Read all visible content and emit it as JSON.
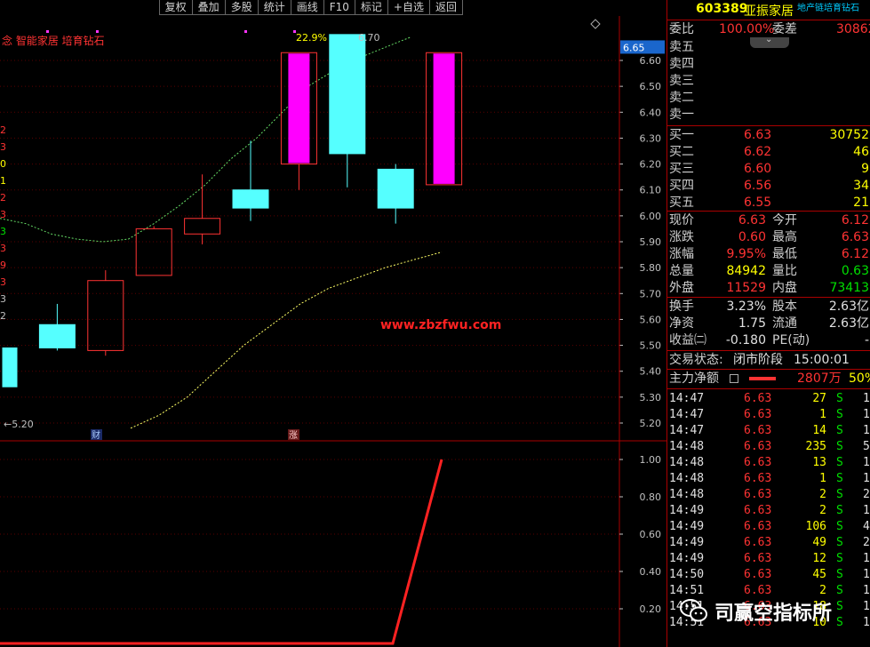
{
  "toolbar": [
    "复权",
    "叠加",
    "多股",
    "统计",
    "画线",
    "F10",
    "标记",
    "+自选",
    "返回"
  ],
  "chart": {
    "concept_label": "念 智能家居 培育钻石",
    "pct_label": "22.9%",
    "price_label": "6.70",
    "low_label": "←5.20",
    "current_price_tag": "6.65",
    "watermark": "www.zbzfwu.com",
    "marker_cai": "财",
    "marker_zhang": "涨",
    "left_axis_digits": [
      "2",
      "3",
      "0",
      "1",
      "2",
      "3",
      "3",
      "3",
      "9",
      "3",
      "3",
      "2"
    ]
  },
  "chart_data": {
    "type": "candlestick",
    "price_axis": [
      6.6,
      6.5,
      6.4,
      6.3,
      6.2,
      6.1,
      6.0,
      5.9,
      5.8,
      5.7,
      5.6,
      5.5,
      5.4,
      5.3,
      5.2
    ],
    "candles": [
      {
        "o": 5.49,
        "c": 5.34,
        "h": 5.49,
        "l": 5.34,
        "color": "cyan"
      },
      {
        "o": 5.58,
        "c": 5.49,
        "h": 5.66,
        "l": 5.48,
        "color": "cyan"
      },
      {
        "o": 5.48,
        "c": 5.75,
        "h": 5.79,
        "l": 5.46,
        "color": "red"
      },
      {
        "o": 5.77,
        "c": 5.95,
        "h": 5.96,
        "l": 5.77,
        "color": "red"
      },
      {
        "o": 5.93,
        "c": 5.99,
        "h": 6.16,
        "l": 5.89,
        "color": "red"
      },
      {
        "o": 6.03,
        "c": 6.1,
        "h": 6.29,
        "l": 5.98,
        "color": "cyan"
      },
      {
        "o": 6.2,
        "c": 6.63,
        "h": 6.63,
        "l": 6.1,
        "color": "magenta"
      },
      {
        "o": 6.7,
        "c": 6.24,
        "h": 6.7,
        "l": 6.11,
        "color": "cyan"
      },
      {
        "o": 6.18,
        "c": 6.03,
        "h": 6.2,
        "l": 5.97,
        "color": "cyan"
      },
      {
        "o": 6.12,
        "c": 6.63,
        "h": 6.63,
        "l": 6.12,
        "color": "magenta"
      }
    ],
    "ma_fast": [
      5.99,
      5.97,
      5.93,
      5.91,
      5.9,
      5.91,
      5.97,
      6.04,
      6.12,
      6.22,
      6.3,
      6.4,
      6.5,
      6.56,
      6.61,
      6.65,
      6.69
    ],
    "ma_slow": [
      5.18,
      5.23,
      5.3,
      5.4,
      5.5,
      5.58,
      5.66,
      5.72,
      5.76,
      5.8,
      5.83,
      5.86
    ],
    "indicator_axis": [
      1.0,
      0.8,
      0.6,
      0.4,
      0.2
    ],
    "indicator": [
      0,
      0,
      0,
      0,
      0,
      0,
      0,
      0,
      0,
      1.0
    ]
  },
  "panel": {
    "code": "603389",
    "name": "亚振家居",
    "concept": "地产链培育钻石",
    "weibi_label": "委比",
    "weibi": "100.00%",
    "weicha_label": "委差",
    "weicha": "30862",
    "sell": [
      "卖五",
      "卖四",
      "卖三",
      "卖二",
      "卖一"
    ],
    "buy": [
      {
        "label": "买一",
        "price": "6.63",
        "vol": "30752"
      },
      {
        "label": "买二",
        "price": "6.62",
        "vol": "46"
      },
      {
        "label": "买三",
        "price": "6.60",
        "vol": "9"
      },
      {
        "label": "买四",
        "price": "6.56",
        "vol": "34"
      },
      {
        "label": "买五",
        "price": "6.55",
        "vol": "21"
      }
    ],
    "stats": [
      {
        "l1": "现价",
        "v1": "6.63",
        "c1": "red",
        "l2": "今开",
        "v2": "6.12",
        "c2": "red"
      },
      {
        "l1": "涨跌",
        "v1": "0.60",
        "c1": "red",
        "l2": "最高",
        "v2": "6.63",
        "c2": "red"
      },
      {
        "l1": "涨幅",
        "v1": "9.95%",
        "c1": "red",
        "l2": "最低",
        "v2": "6.12",
        "c2": "red"
      },
      {
        "l1": "总量",
        "v1": "84942",
        "c1": "yel",
        "l2": "量比",
        "v2": "0.63",
        "c2": "grn"
      },
      {
        "l1": "外盘",
        "v1": "11529",
        "c1": "red",
        "l2": "内盘",
        "v2": "73413",
        "c2": "grn"
      }
    ],
    "stats2": [
      {
        "l1": "换手",
        "v1": "3.23%",
        "l2": "股本",
        "v2": "2.63亿"
      },
      {
        "l1": "净资",
        "v1": "1.75",
        "l2": "流通",
        "v2": "2.63亿"
      },
      {
        "l1": "收益㈡",
        "v1": "-0.180",
        "l2": "PE(动)",
        "v2": "-"
      }
    ],
    "status_label": "交易状态:",
    "status_value": "闭市阶段",
    "status_time": "15:00:01",
    "main_label": "主力净额",
    "main_value": "2807万",
    "main_pct": "50%",
    "ticks": [
      {
        "t": "14:47",
        "p": "6.63",
        "v": "27",
        "d": "S",
        "n": "1"
      },
      {
        "t": "14:47",
        "p": "6.63",
        "v": "1",
        "d": "S",
        "n": "1"
      },
      {
        "t": "14:47",
        "p": "6.63",
        "v": "14",
        "d": "S",
        "n": "1"
      },
      {
        "t": "14:48",
        "p": "6.63",
        "v": "235",
        "d": "S",
        "n": "5"
      },
      {
        "t": "14:48",
        "p": "6.63",
        "v": "13",
        "d": "S",
        "n": "1"
      },
      {
        "t": "14:48",
        "p": "6.63",
        "v": "1",
        "d": "S",
        "n": "1"
      },
      {
        "t": "14:48",
        "p": "6.63",
        "v": "2",
        "d": "S",
        "n": "2"
      },
      {
        "t": "14:49",
        "p": "6.63",
        "v": "2",
        "d": "S",
        "n": "1"
      },
      {
        "t": "14:49",
        "p": "6.63",
        "v": "106",
        "d": "S",
        "n": "4"
      },
      {
        "t": "14:49",
        "p": "6.63",
        "v": "49",
        "d": "S",
        "n": "2"
      },
      {
        "t": "14:49",
        "p": "6.63",
        "v": "12",
        "d": "S",
        "n": "1"
      },
      {
        "t": "14:50",
        "p": "6.63",
        "v": "45",
        "d": "S",
        "n": "1"
      },
      {
        "t": "14:51",
        "p": "6.63",
        "v": "2",
        "d": "S",
        "n": "1"
      },
      {
        "t": "14:51",
        "p": "6.63",
        "v": "18",
        "d": "S",
        "n": "1"
      },
      {
        "t": "14:51",
        "p": "6.63",
        "v": "10",
        "d": "S",
        "n": "1"
      }
    ]
  },
  "corner_watermark": "司赢空指标所",
  "colors": {
    "up": "#ff3333",
    "down_fill": "#55ffff",
    "limit": "#ff00ff",
    "ma_fast": "#66dd66",
    "ma_slow": "#ffff66",
    "grid": "#5a0000",
    "axis": "#c0c0c0"
  }
}
